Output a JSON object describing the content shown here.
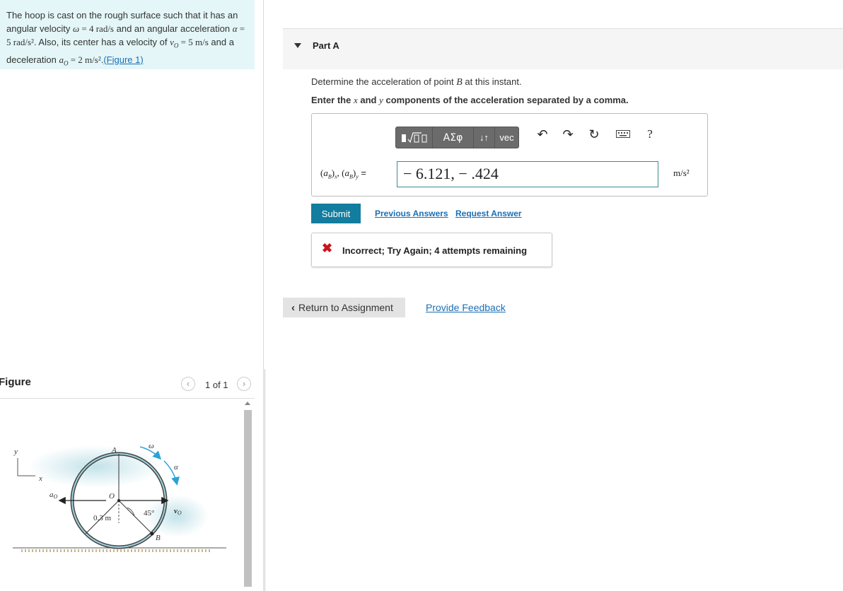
{
  "problem": {
    "text_1": "The hoop is cast on the rough surface such that it has an angular velocity ",
    "omega_sym": "ω",
    "omega_val": " = 4 rad/s",
    "text_2": " and an angular acceleration ",
    "alpha_sym": "α",
    "alpha_val": " = 5 rad/s²",
    "text_3": ". Also, its center has a velocity of ",
    "v_sym": "v",
    "v_sub": "O",
    "v_val": " = 5 m/s",
    "text_4": " and a deceleration ",
    "a_sym": "a",
    "a_sub": "O",
    "a_val": " = 2 m/s²",
    "text_5": ".",
    "figure_link": "(Figure 1)"
  },
  "figure": {
    "title": "Figure",
    "counter": "1 of 1",
    "prev_icon": "chevron-left-icon",
    "next_icon": "chevron-right-icon",
    "labels": {
      "y": "y",
      "x": "x",
      "a_o": "a",
      "a_o_sub": "O",
      "A": "A",
      "omega": "ω",
      "alpha": "α",
      "O": "O",
      "v_o": "v",
      "v_o_sub": "O",
      "radius": "0.3 m",
      "angle": "45°",
      "B": "B"
    }
  },
  "part": {
    "title": "Part A",
    "question_1": "Determine the acceleration of point ",
    "question_B": "B",
    "question_2": " at this instant.",
    "instr_1": "Enter the ",
    "instr_x": "x",
    "instr_2": " and ",
    "instr_y": "y",
    "instr_3": " components of the acceleration separated by a comma."
  },
  "toolbar": {
    "templates_icon": "sqrt-template-icon",
    "greek_label": "ΑΣφ",
    "arrows_label": "↓↑",
    "vec_label": "vec",
    "undo": "↶",
    "redo": "↷",
    "reset": "↻",
    "keyboard_icon": "keyboard-icon",
    "help": "?"
  },
  "answer": {
    "label": "(a_B)_x, (a_B)_y =",
    "value": "− 6.121, − .424",
    "units": "m/s²"
  },
  "actions": {
    "submit": "Submit",
    "previous_answers": "Previous Answers",
    "request_answer": "Request Answer"
  },
  "feedback": {
    "icon": "x-icon",
    "text": "Incorrect; Try Again; 4 attempts remaining"
  },
  "nav": {
    "return": "Return to Assignment",
    "provide_feedback": "Provide Feedback"
  },
  "colors": {
    "problem_bg": "#e4f6f7",
    "link": "#1a6fb5",
    "submit_bg": "#127d9e",
    "error": "#c8161d",
    "arrow": "#29a3d6"
  }
}
